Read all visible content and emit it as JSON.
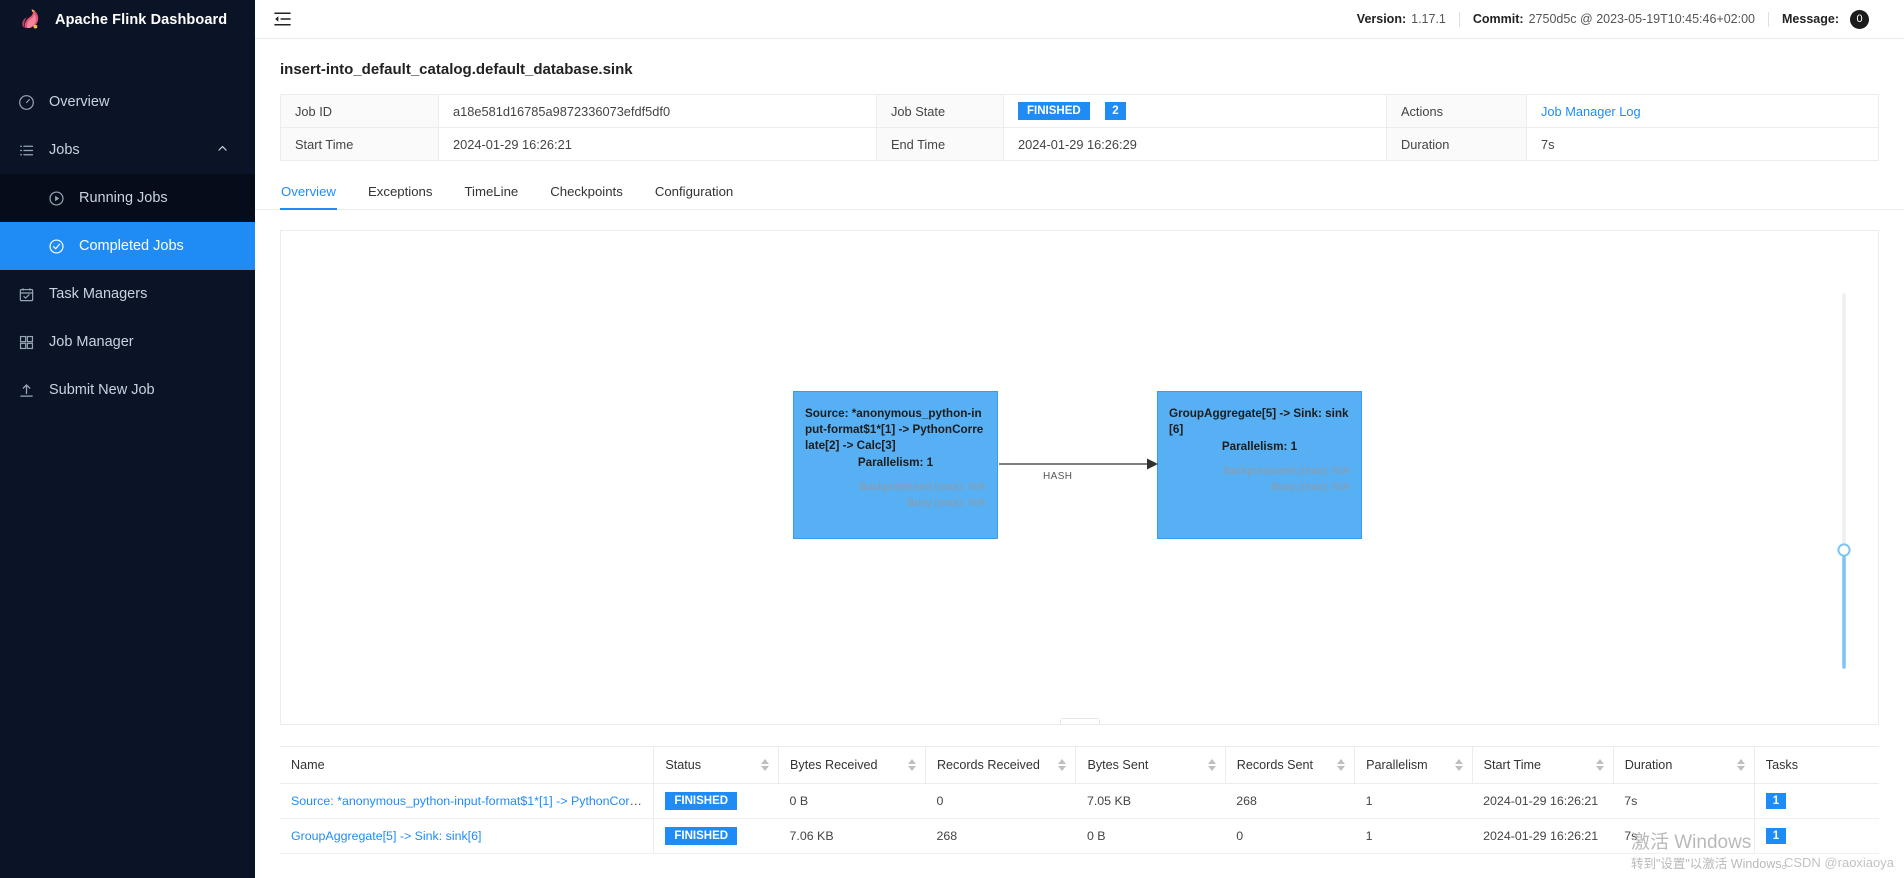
{
  "sidebar": {
    "brand": "Apache Flink Dashboard",
    "items": [
      {
        "label": "Overview",
        "icon": "gauge-icon"
      },
      {
        "label": "Jobs",
        "icon": "list-icon",
        "expanded": true
      },
      {
        "label": "Running Jobs",
        "icon": "play-circle-icon",
        "sub": true
      },
      {
        "label": "Completed Jobs",
        "icon": "check-circle-icon",
        "sub": true,
        "active": true
      },
      {
        "label": "Task Managers",
        "icon": "calendar-check-icon"
      },
      {
        "label": "Job Manager",
        "icon": "grid-icon"
      },
      {
        "label": "Submit New Job",
        "icon": "upload-icon"
      }
    ]
  },
  "topbar": {
    "menu_icon": "hamburger-icon",
    "version_label": "Version:",
    "version_value": "1.17.1",
    "commit_label": "Commit:",
    "commit_value": "2750d5c @ 2023-05-19T10:45:46+02:00",
    "message_label": "Message:",
    "message_count": "0"
  },
  "job": {
    "title": "insert-into_default_catalog.default_database.sink",
    "job_id_label": "Job ID",
    "job_id_value": "a18e581d16785a9872336073efdf5df0",
    "job_state_label": "Job State",
    "job_state_value": "FINISHED",
    "job_state_count": "2",
    "actions_label": "Actions",
    "actions_link": "Job Manager Log",
    "start_time_label": "Start Time",
    "start_time_value": "2024-01-29 16:26:21",
    "end_time_label": "End Time",
    "end_time_value": "2024-01-29 16:26:29",
    "duration_label": "Duration",
    "duration_value": "7s"
  },
  "tabs": [
    {
      "label": "Overview",
      "active": true
    },
    {
      "label": "Exceptions",
      "active": false
    },
    {
      "label": "TimeLine",
      "active": false
    },
    {
      "label": "Checkpoints",
      "active": false
    },
    {
      "label": "Configuration",
      "active": false
    }
  ],
  "graph": {
    "nodes": [
      {
        "name": "Source: *anonymous_python-input-format$1*[1] -> PythonCorrelate[2] -> Calc[3]",
        "parallelism": "Parallelism: 1",
        "backpressured": "Backpressured (max): N/A",
        "busy": "Busy (max): N/A"
      },
      {
        "name": "GroupAggregate[5] -> Sink: sink[6]",
        "parallelism": "Parallelism: 1",
        "backpressured": "Backpressured (max): N/A",
        "busy": "Busy (max): N/A"
      }
    ],
    "edge_label": "HASH"
  },
  "vertex_table": {
    "columns": [
      {
        "label": "Name",
        "sortable": false
      },
      {
        "label": "Status",
        "sortable": true
      },
      {
        "label": "Bytes Received",
        "sortable": true
      },
      {
        "label": "Records Received",
        "sortable": true
      },
      {
        "label": "Bytes Sent",
        "sortable": true
      },
      {
        "label": "Records Sent",
        "sortable": true
      },
      {
        "label": "Parallelism",
        "sortable": true
      },
      {
        "label": "Start Time",
        "sortable": true
      },
      {
        "label": "Duration",
        "sortable": true
      },
      {
        "label": "Tasks",
        "sortable": false
      }
    ],
    "rows": [
      {
        "name": "Source: *anonymous_python-input-format$1*[1] -> PythonCorrelate[...",
        "status": "FINISHED",
        "bytes_received": "0 B",
        "records_received": "0",
        "bytes_sent": "7.05 KB",
        "records_sent": "268",
        "parallelism": "1",
        "start_time": "2024-01-29 16:26:21",
        "duration": "7s",
        "tasks": "1"
      },
      {
        "name": "GroupAggregate[5] -> Sink: sink[6]",
        "status": "FINISHED",
        "bytes_received": "7.06 KB",
        "records_received": "268",
        "bytes_sent": "0 B",
        "records_sent": "0",
        "parallelism": "1",
        "start_time": "2024-01-29 16:26:21",
        "duration": "7s",
        "tasks": "1"
      }
    ]
  },
  "watermarks": {
    "windows_line1": "激活 Windows",
    "windows_line2": "转到\"设置\"以激活 Windows。",
    "csdn": "CSDN @raoxiaoya"
  },
  "colors": {
    "accent": "#1f8cf5",
    "sidebar_bg": "#0b1426",
    "node_fill": "#58b0f4"
  }
}
